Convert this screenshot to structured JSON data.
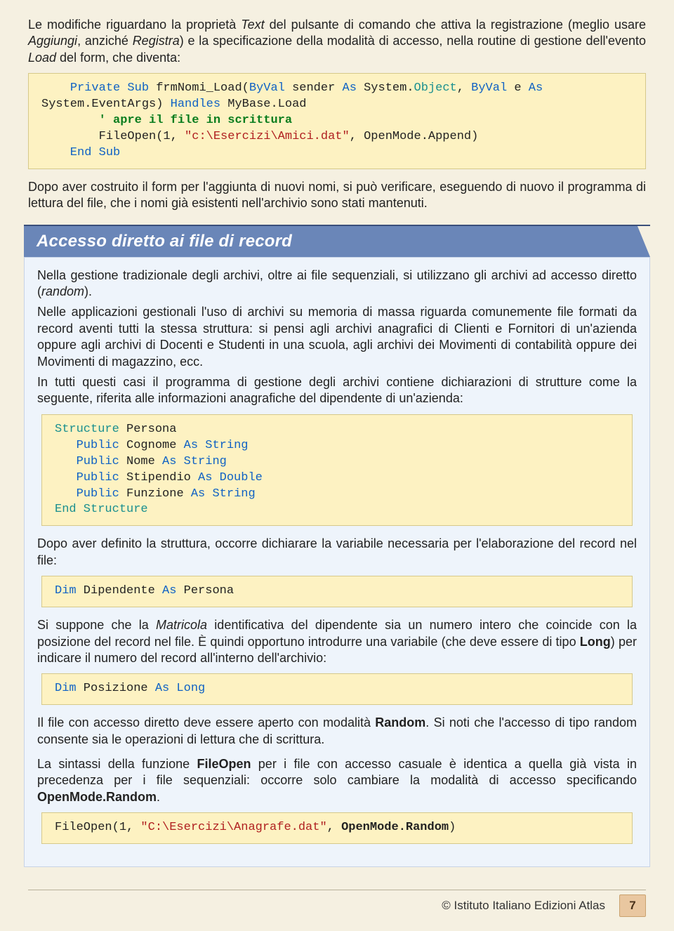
{
  "intro": {
    "p1_a": "Le modifiche riguardano la proprietà ",
    "p1_b": "Text",
    "p1_c": " del pulsante di comando che attiva la registrazione (meglio usare ",
    "p1_d": "Aggiungi",
    "p1_e": ", anziché ",
    "p1_f": "Registra",
    "p1_g": ") e la specificazione della modalità di accesso, nella routine di gestione dell'evento ",
    "p1_h": "Load",
    "p1_i": " del form, che diventa:"
  },
  "code1": {
    "l1a": "Private Sub",
    "l1b": " frmNomi_Load(",
    "l1c": "ByVal",
    "l1d": " sender ",
    "l1e": "As",
    "l1f": " System.",
    "l1g": "Object",
    "l1h": ", ",
    "l1i": "ByVal",
    "l1j": " e ",
    "l1k": "As",
    "l2a": "System.EventArgs) ",
    "l2b": "Handles",
    "l2c": " MyBase.Load",
    "l3": "        ' apre il file in scrittura",
    "l4a": "        FileOpen(1, ",
    "l4b": "\"c:\\Esercizi\\Amici.dat\"",
    "l4c": ", OpenMode.Append)",
    "l5": "    End Sub"
  },
  "after1": "Dopo aver costruito il form per l'aggiunta di nuovi nomi, si può verificare, eseguendo di nuovo il programma di lettura del file, che i nomi già esistenti nell'archivio sono stati mantenuti.",
  "section": {
    "title": "Accesso diretto ai file di record",
    "p1a": "Nella gestione tradizionale degli archivi, oltre ai file sequenziali, si utilizzano gli archivi ad accesso diretto (",
    "p1b": "random",
    "p1c": ").",
    "p2": "Nelle applicazioni gestionali l'uso di archivi su memoria di massa riguarda comunemente file formati da record aventi tutti la stessa struttura: si pensi agli archivi anagrafici di Clienti e Fornitori di un'azienda oppure agli archivi di Docenti e Studenti in una scuola, agli archivi dei Movimenti di contabilità oppure dei Movimenti di magazzino, ecc.",
    "p3": "In tutti questi casi il programma di gestione degli archivi contiene dichiarazioni di strutture come la seguente, riferita alle informazioni anagrafiche del dipendente di un'azienda:",
    "code2": {
      "l1a": "Structure",
      "l1b": " Persona",
      "l2a": "   Public",
      "l2b": " Cognome ",
      "l2c": "As String",
      "l3a": "   Public",
      "l3b": " Nome ",
      "l3c": "As String",
      "l4a": "   Public",
      "l4b": " Stipendio ",
      "l4c": "As Double",
      "l5a": "   Public",
      "l5b": " Funzione ",
      "l5c": "As String",
      "l6": "End Structure"
    },
    "p4": "Dopo aver definito la struttura, occorre dichiarare la variabile necessaria per l'elaborazione del record nel file:",
    "code3": {
      "a": "Dim",
      "b": " Dipendente ",
      "c": "As",
      "d": " Persona"
    },
    "p5a": "Si suppone che la ",
    "p5b": "Matricola",
    "p5c": " identificativa del dipendente sia un numero intero che coincide con la posizione del record nel file. È quindi opportuno introdurre una variabile (che deve essere di tipo ",
    "p5d": "Long",
    "p5e": ") per indicare il numero del record all'interno dell'archivio:",
    "code4": {
      "a": "Dim",
      "b": " Posizione ",
      "c": "As Long"
    },
    "p6a": "Il file con accesso diretto deve essere aperto con modalità ",
    "p6b": "Random",
    "p6c": ". Si noti che l'accesso di tipo random consente sia le operazioni di lettura che di scrittura.",
    "p7a": "La sintassi della funzione ",
    "p7b": "FileOpen",
    "p7c": " per i file con accesso casuale è identica a quella già vista in precedenza per i file sequenziali: occorre solo cambiare la modalità di accesso specificando ",
    "p7d": "OpenMode.Random",
    "p7e": ".",
    "code5": {
      "a": "FileOpen(1, ",
      "b": "\"C:\\Esercizi\\Anagrafe.dat\"",
      "c": ", ",
      "d": "OpenMode.Random",
      "e": ")"
    }
  },
  "footer": {
    "copyright": "© Istituto Italiano Edizioni Atlas",
    "page": "7"
  }
}
